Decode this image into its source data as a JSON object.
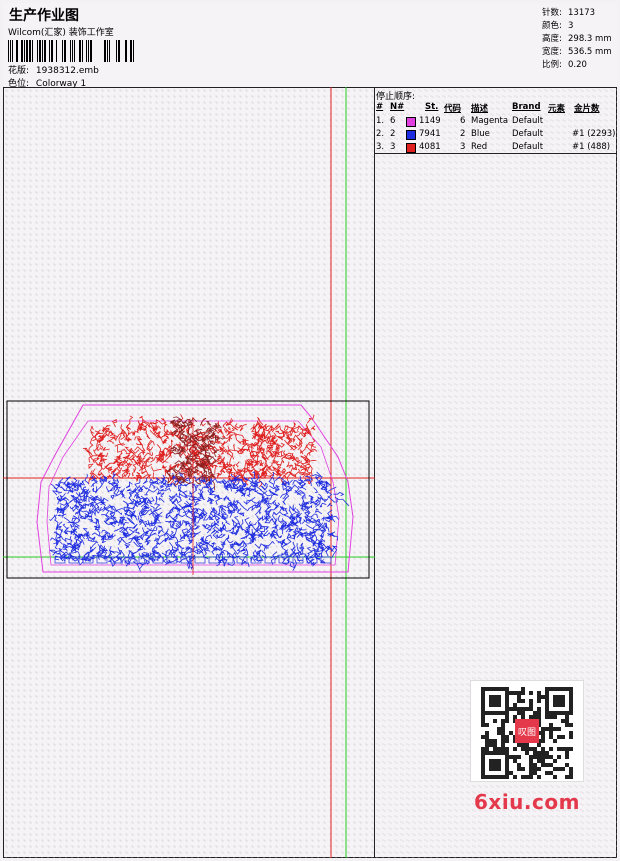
{
  "header": {
    "title": "生产作业图",
    "company": "Wilcom(汇家) 装饰工作室",
    "design_label": "花版:",
    "design_file": "1938312.emb",
    "colorway_label": "色位:",
    "colorway": "Colorway 1"
  },
  "stats": [
    {
      "label": "针数:",
      "value": "13173"
    },
    {
      "label": "颜色:",
      "value": "3"
    },
    {
      "label": "高度:",
      "value": "298.3 mm"
    },
    {
      "label": "宽度:",
      "value": "536.5 mm"
    },
    {
      "label": "比例:",
      "value": "0.20"
    }
  ],
  "stop_sequence": {
    "title": "停止顺序:",
    "columns": [
      "#",
      "N#",
      "St.",
      "代码",
      "描述",
      "Brand",
      "元素",
      "金片数"
    ],
    "rows": [
      {
        "idx": "1.",
        "n": "6",
        "color": "#e040e0",
        "st": "1149",
        "code": "6",
        "desc": "Magenta",
        "brand": "Default",
        "element": "",
        "sequin": ""
      },
      {
        "idx": "2.",
        "n": "2",
        "color": "#1f2de0",
        "st": "7941",
        "code": "2",
        "desc": "Blue",
        "brand": "Default",
        "element": "",
        "sequin": "#1 (2293)"
      },
      {
        "idx": "3.",
        "n": "3",
        "color": "#e02020",
        "st": "4081",
        "code": "3",
        "desc": "Red",
        "brand": "Default",
        "element": "",
        "sequin": "#1 (488)"
      }
    ]
  },
  "watermark": {
    "qr_badge": "叹图",
    "site": "6xiu.com"
  },
  "colors": {
    "magenta": "#e040e0",
    "blue": "#1f2de0",
    "red": "#e02020",
    "green_guide": "#22cc22",
    "red_guide": "#e02020"
  }
}
